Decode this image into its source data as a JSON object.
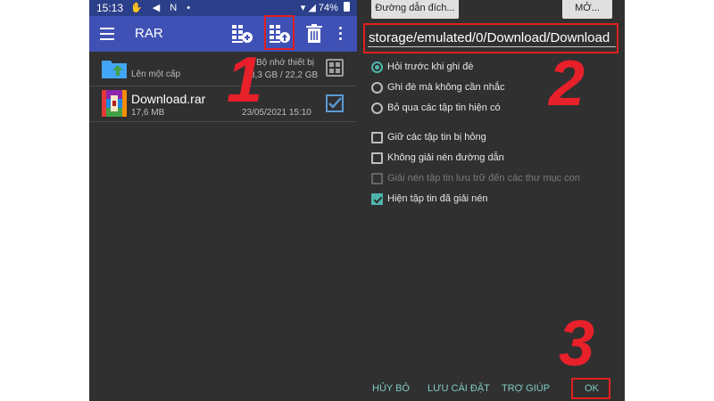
{
  "left_screen": {
    "status_bar": {
      "time": "15:13",
      "icons": "✋ ◀ N •",
      "battery": "74%"
    },
    "toolbar": {
      "title": "RAR",
      "icons": [
        "menu-icon",
        "add-archive-icon",
        "extract-icon",
        "delete-icon",
        "more-icon"
      ]
    },
    "parent_row": {
      "label": "Lên một cấp",
      "storage_name": "Bộ nhớ thiết bị",
      "storage_size": "3,3 GB / 22,2 GB"
    },
    "files": [
      {
        "name": "Download.rar",
        "size": "17,6 MB",
        "date": "23/05/2021 15:10",
        "checked": true
      }
    ]
  },
  "right_screen": {
    "dest_button": "Đường dẫn đích...",
    "open_button": "MỞ...",
    "path": "storage/emulated/0/Download/Download",
    "overwrite_options": [
      {
        "label": "Hỏi trước khi ghi đè",
        "selected": true
      },
      {
        "label": "Ghi đè mà không cần nhắc",
        "selected": false
      },
      {
        "label": "Bỏ qua các tập tin hiện có",
        "selected": false
      }
    ],
    "checkbox_options": [
      {
        "label": "Giữ các tập tin bị hỏng",
        "checked": false,
        "enabled": true
      },
      {
        "label": "Không giải nén đường dẫn",
        "checked": false,
        "enabled": true
      },
      {
        "label": "Giải nén tập tin lưu trữ đến các thư mục con",
        "checked": false,
        "enabled": false
      },
      {
        "label": "Hiện tập tin đã giải nén",
        "checked": true,
        "enabled": true
      }
    ],
    "buttons": {
      "cancel": "HỦY BỎ",
      "save_settings": "LƯU CÀI ĐẶT",
      "help": "TRỢ GIÚP",
      "ok": "OK"
    }
  },
  "step_numbers": {
    "one": "1",
    "two": "2",
    "three": "3"
  },
  "colors": {
    "toolbar": "#3f51b5",
    "status_bar": "#2b3f8a",
    "background": "#303030",
    "accent": "#4db6ac",
    "annotation_red": "#e8202a"
  }
}
